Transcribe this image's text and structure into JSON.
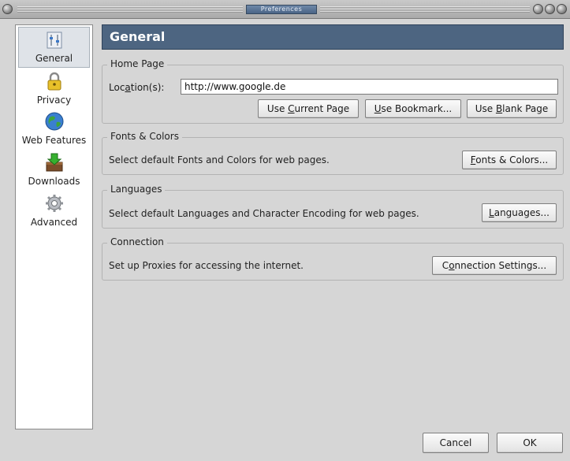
{
  "window": {
    "title": "Preferences"
  },
  "sidebar": {
    "items": [
      {
        "label": "General",
        "icon": "general-icon",
        "selected": true
      },
      {
        "label": "Privacy",
        "icon": "lock-icon"
      },
      {
        "label": "Web Features",
        "icon": "globe-icon"
      },
      {
        "label": "Downloads",
        "icon": "download-icon"
      },
      {
        "label": "Advanced",
        "icon": "gear-icon"
      }
    ]
  },
  "panel": {
    "title": "General"
  },
  "home_page": {
    "legend": "Home Page",
    "location_label_pre": "Loc",
    "location_label_key": "a",
    "location_label_post": "tion(s):",
    "location_value": "http://www.google.de",
    "use_current_pre": "Use ",
    "use_current_key": "C",
    "use_current_post": "urrent Page",
    "use_bookmark_pre": "",
    "use_bookmark_key": "U",
    "use_bookmark_post": "se Bookmark...",
    "use_blank_pre": "Use ",
    "use_blank_key": "B",
    "use_blank_post": "lank Page"
  },
  "fonts_colors": {
    "legend": "Fonts & Colors",
    "description": "Select default Fonts and Colors for web pages.",
    "button_key": "F",
    "button_post": "onts & Colors..."
  },
  "languages": {
    "legend": "Languages",
    "description": "Select default Languages and Character Encoding for web pages.",
    "button_key": "L",
    "button_post": "anguages..."
  },
  "connection": {
    "legend": "Connection",
    "description": "Set up Proxies for accessing the internet.",
    "button_pre": "C",
    "button_key": "o",
    "button_post": "nnection Settings..."
  },
  "footer": {
    "cancel_label": "Cancel",
    "ok_label": "OK"
  },
  "colors": {
    "header_bg": "#4d6581",
    "window_bg": "#d6d6d6",
    "title_plate": "#4a6486"
  }
}
